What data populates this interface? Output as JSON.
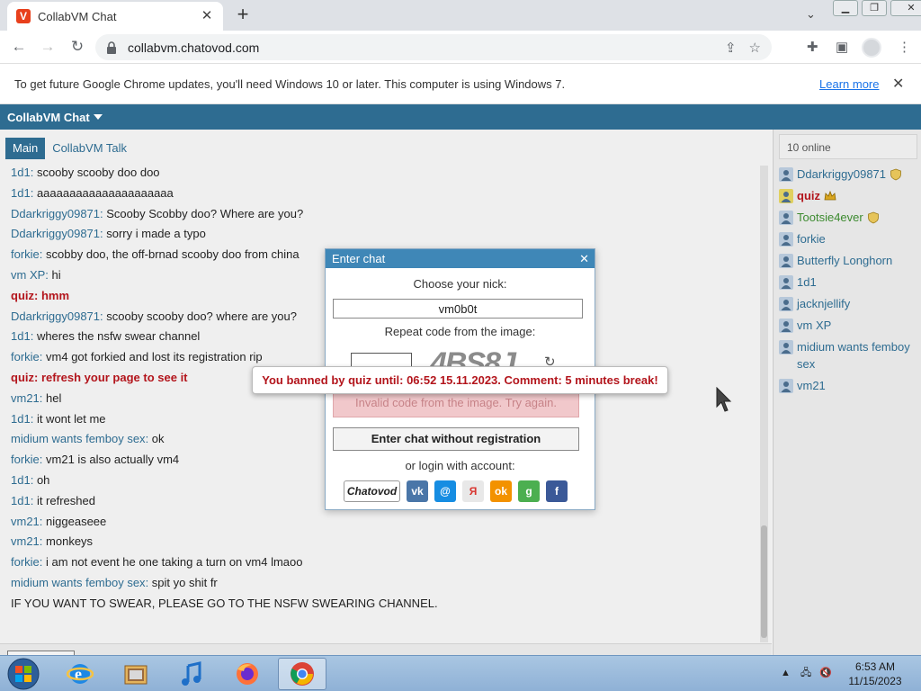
{
  "browser": {
    "tab_title": "CollabVM Chat",
    "url": "collabvm.chatovod.com",
    "infobar_text": "To get future Google Chrome updates, you'll need Windows 10 or later. This computer is using Windows 7.",
    "infobar_link": "Learn more"
  },
  "app": {
    "title": "CollabVM Chat",
    "tabs": [
      {
        "label": "Main",
        "active": true
      },
      {
        "label": "CollabVM Talk",
        "active": false
      }
    ],
    "messages": [
      {
        "nick": "1d1",
        "text": "scooby scooby doo doo",
        "style": "normal"
      },
      {
        "nick": "1d1",
        "text": "aaaaaaaaaaaaaaaaaaaaa",
        "style": "normal"
      },
      {
        "nick": "Ddarkriggy09871",
        "text": "Scooby Scobby doo? Where are you?",
        "style": "normal"
      },
      {
        "nick": "Ddarkriggy09871",
        "text": "sorry i made a typo",
        "style": "normal"
      },
      {
        "nick": "forkie",
        "text": "scobby doo, the off-brnad scooby doo from china",
        "style": "normal"
      },
      {
        "nick": "vm XP",
        "text": "hi",
        "style": "normal"
      },
      {
        "nick": "quiz",
        "text": "hmm",
        "style": "red"
      },
      {
        "nick": "Ddarkriggy09871",
        "text": "scooby scooby doo? where are you?",
        "style": "normal"
      },
      {
        "nick": "1d1",
        "text": "wheres the nsfw swear channel",
        "style": "normal"
      },
      {
        "nick": "forkie",
        "text": "vm4 got forkied and lost its registration rip",
        "style": "normal"
      },
      {
        "nick": "quiz",
        "text": "refresh your page to see it",
        "style": "red"
      },
      {
        "nick": "vm21",
        "text": "hel",
        "style": "normal"
      },
      {
        "nick": "1d1",
        "text": "it wont let me",
        "style": "normal"
      },
      {
        "nick": "midium wants femboy sex",
        "text": "ok",
        "style": "normal"
      },
      {
        "nick": "forkie",
        "text": "vm21 is also actually vm4",
        "style": "normal"
      },
      {
        "nick": "1d1",
        "text": "oh",
        "style": "normal"
      },
      {
        "nick": "1d1",
        "text": "it refreshed",
        "style": "normal"
      },
      {
        "nick": "vm21",
        "text": "niggeaseee",
        "style": "normal"
      },
      {
        "nick": "vm21",
        "text": "monkeys",
        "style": "normal"
      },
      {
        "nick": "forkie",
        "text": "i am not event he one taking a turn on vm4 lmaoo",
        "style": "normal"
      },
      {
        "nick": "midium wants femboy sex",
        "text": "spit yo shit fr",
        "style": "normal"
      },
      {
        "nick": "",
        "text": "IF YOU WANT TO SWEAR, PLEASE GO TO THE NSFW SWEARING CHANNEL.",
        "style": "system"
      }
    ],
    "enter_chat_button": "Enter chat"
  },
  "sidebar": {
    "online_count": "10 online",
    "users": [
      {
        "name": "Ddarkriggy09871",
        "color": "blue",
        "badge": "shield"
      },
      {
        "name": "quiz",
        "color": "red",
        "badge": "crown"
      },
      {
        "name": "Tootsie4ever",
        "color": "green",
        "badge": "shield"
      },
      {
        "name": "forkie",
        "color": "blue",
        "badge": ""
      },
      {
        "name": "Butterfly Longhorn",
        "color": "blue",
        "badge": ""
      },
      {
        "name": "1d1",
        "color": "blue",
        "badge": ""
      },
      {
        "name": "jacknjellify",
        "color": "blue",
        "badge": ""
      },
      {
        "name": "vm XP",
        "color": "blue",
        "badge": ""
      },
      {
        "name": "midium wants femboy sex",
        "color": "blue",
        "badge": ""
      },
      {
        "name": "vm21",
        "color": "blue",
        "badge": ""
      }
    ]
  },
  "dialog": {
    "title": "Enter chat",
    "nick_label": "Choose your nick:",
    "nick_value": "vm0b0t",
    "captcha_label": "Repeat code from the image:",
    "captcha_text": "4BS8J",
    "error": "Invalid code from the image. Try again.",
    "no_reg_button": "Enter chat without registration",
    "login_label": "or login with account:",
    "social": [
      {
        "name": "chatovod",
        "label": "Chatovod",
        "color": "#ffffff"
      },
      {
        "name": "vk",
        "label": "vk",
        "color": "#4a76a8"
      },
      {
        "name": "mailru",
        "label": "@",
        "color": "#168de2"
      },
      {
        "name": "yandex",
        "label": "Я",
        "color": "#e8e8e8"
      },
      {
        "name": "odnoklassniki",
        "label": "ok",
        "color": "#f39200"
      },
      {
        "name": "google",
        "label": "g",
        "color": "#4caf50"
      },
      {
        "name": "facebook",
        "label": "f",
        "color": "#3b5998"
      }
    ]
  },
  "tooltip": {
    "text": "You banned by quiz until: 06:52 15.11.2023. Comment: 5 minutes break!"
  },
  "taskbar": {
    "time": "6:53 AM",
    "date": "11/15/2023"
  }
}
